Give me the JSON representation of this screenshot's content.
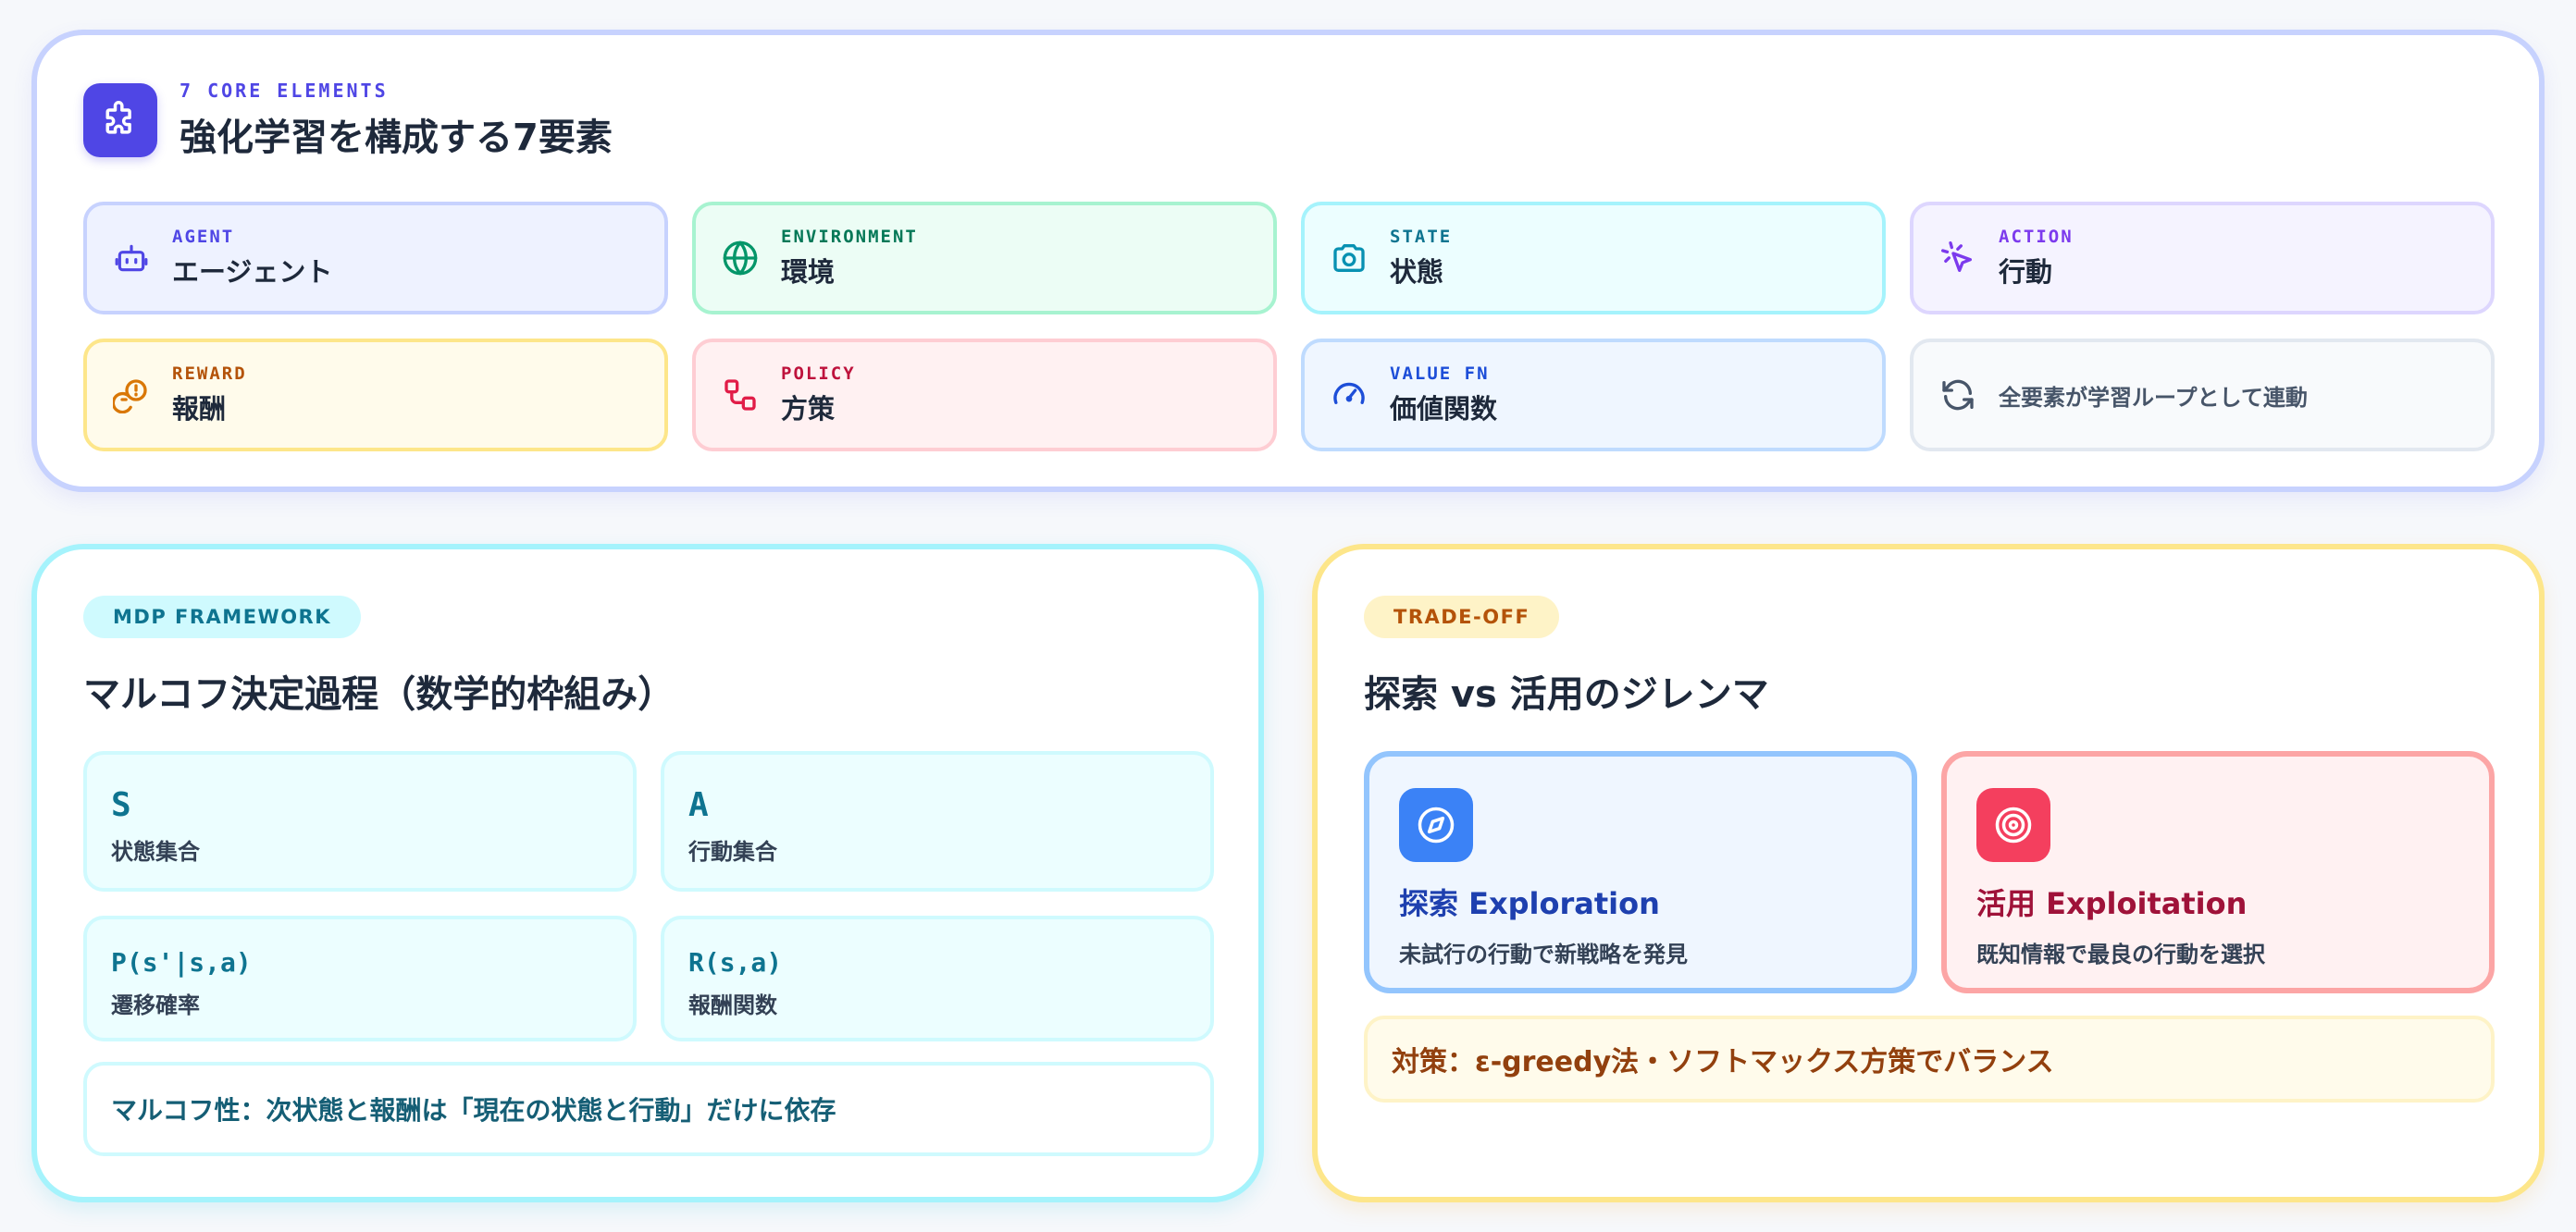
{
  "core": {
    "eyebrow": "7 CORE ELEMENTS",
    "title": "強化学習を構成する7要素",
    "elements": [
      {
        "code": "AGENT",
        "name": "エージェント",
        "icon": "robot-icon"
      },
      {
        "code": "ENVIRONMENT",
        "name": "環境",
        "icon": "globe-icon"
      },
      {
        "code": "STATE",
        "name": "状態",
        "icon": "camera-icon"
      },
      {
        "code": "ACTION",
        "name": "行動",
        "icon": "cursor-click-icon"
      },
      {
        "code": "REWARD",
        "name": "報酬",
        "icon": "coins-icon"
      },
      {
        "code": "POLICY",
        "name": "方策",
        "icon": "route-icon"
      },
      {
        "code": "VALUE FN",
        "name": "価値関数",
        "icon": "gauge-icon"
      }
    ],
    "loop_text": "全要素が学習ループとして連動",
    "loop_icon": "refresh-icon"
  },
  "mdp": {
    "tag": "MDP FRAMEWORK",
    "title": "マルコフ決定過程（数学的枠組み）",
    "items": [
      {
        "symbol": "S",
        "label": "状態集合"
      },
      {
        "symbol": "A",
        "label": "行動集合"
      },
      {
        "symbol": "P(s'|s,a)",
        "label": "遷移確率"
      },
      {
        "symbol": "R(s,a)",
        "label": "報酬関数"
      }
    ],
    "markov_note": "マルコフ性：次状態と報酬は「現在の状態と行動」だけに依存"
  },
  "tradeoff": {
    "tag": "TRADE-OFF",
    "title": "探索 vs 活用のジレンマ",
    "explore": {
      "name": "探索 Exploration",
      "desc": "未試行の行動で新戦略を発見",
      "icon": "compass-icon"
    },
    "exploit": {
      "name": "活用 Exploitation",
      "desc": "既知情報で最良の行動を選択",
      "icon": "target-icon"
    },
    "solution": "対策：ε-greedy法・ソフトマックス方策でバランス"
  },
  "colors": {
    "indigo": "#4f46e5",
    "cyan": "#0e7490",
    "amber": "#b45309",
    "blue": "#3b82f6",
    "rose": "#f43f5e"
  }
}
